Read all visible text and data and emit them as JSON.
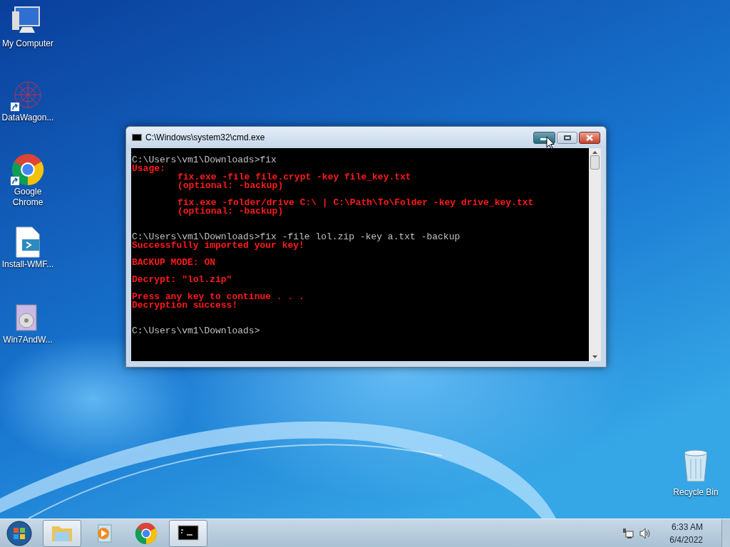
{
  "desktop_icons": [
    {
      "kind": "computer",
      "label": "My Computer",
      "shortcut": false
    },
    {
      "kind": "network",
      "label": "DataWagon...",
      "shortcut": true
    },
    {
      "kind": "chrome",
      "label": "Google Chrome",
      "shortcut": true
    },
    {
      "kind": "script",
      "label": "Install-WMF...",
      "shortcut": false
    },
    {
      "kind": "installer",
      "label": "Win7AndW...",
      "shortcut": false
    }
  ],
  "window": {
    "title": "C:\\Windows\\system32\\cmd.exe"
  },
  "console": {
    "lines": [
      {
        "kind": "prompt",
        "text": "C:\\Users\\vm1\\Downloads>fix"
      },
      {
        "kind": "output",
        "text": "Usage:"
      },
      {
        "kind": "indented",
        "text": "fix.exe -file file.crypt -key file_key.txt"
      },
      {
        "kind": "indented",
        "text": "(optional: -backup)"
      },
      {
        "kind": "blank"
      },
      {
        "kind": "indented",
        "text": "fix.exe -folder/drive C:\\ | C:\\Path\\To\\Folder -key drive_key.txt"
      },
      {
        "kind": "indented",
        "text": "(optional: -backup)"
      },
      {
        "kind": "blank"
      },
      {
        "kind": "blank"
      },
      {
        "kind": "prompt",
        "text": "C:\\Users\\vm1\\Downloads>fix -file lol.zip -key a.txt -backup"
      },
      {
        "kind": "output",
        "text": "Successfully imported your key!"
      },
      {
        "kind": "blank"
      },
      {
        "kind": "output",
        "text": "BACKUP MODE: ON"
      },
      {
        "kind": "blank"
      },
      {
        "kind": "output",
        "text": "Decrypt: \"lol.zip\""
      },
      {
        "kind": "blank"
      },
      {
        "kind": "output",
        "text": "Press any key to continue . . ."
      },
      {
        "kind": "output",
        "text": "Decryption success!"
      },
      {
        "kind": "blank"
      },
      {
        "kind": "blank"
      },
      {
        "kind": "prompt",
        "text": "C:\\Users\\vm1\\Downloads>"
      }
    ]
  },
  "recycle_bin": {
    "label": "Recycle Bin"
  },
  "taskbar": {
    "items": [
      {
        "kind": "explorer",
        "running": true
      },
      {
        "kind": "media",
        "running": false
      },
      {
        "kind": "chrome",
        "running": false
      },
      {
        "kind": "cmd",
        "running": true
      }
    ],
    "time": "6:33 AM",
    "date": "6/4/2022"
  }
}
